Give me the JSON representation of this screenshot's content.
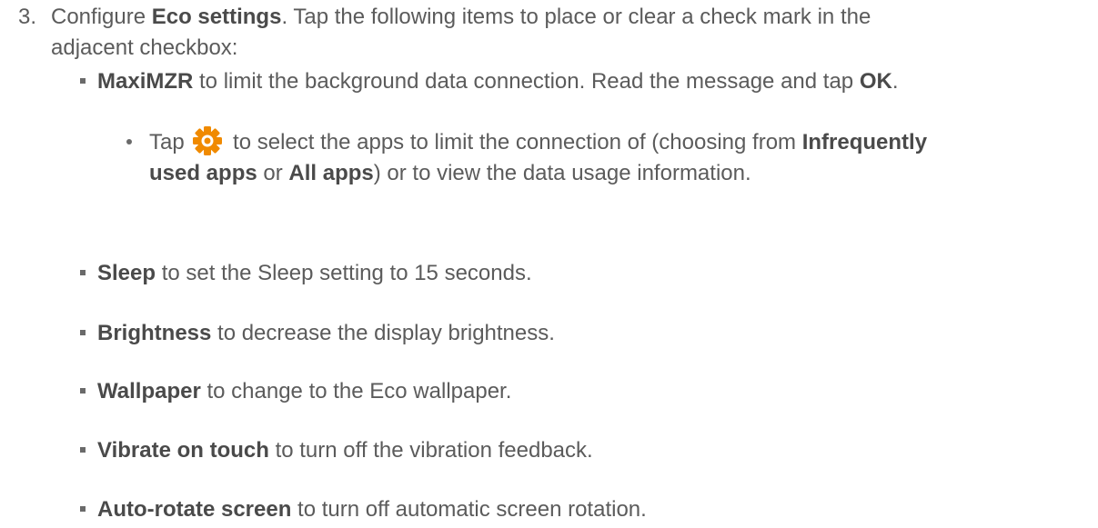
{
  "step": {
    "number": "3.",
    "line1": {
      "t1": "Configure ",
      "b1": "Eco settings",
      "t2": ". Tap the following items to place or clear a check mark in the"
    },
    "line2": "adjacent checkbox:"
  },
  "bullets": [
    {
      "bold": "MaxiMZR",
      "text": " to limit the background data connection. Read the message and tap ",
      "bold2": "OK",
      "text2": "."
    },
    {
      "bold": "Sleep",
      "text": " to set the Sleep setting to 15 seconds."
    },
    {
      "bold": "Brightness",
      "text": " to decrease the display brightness."
    },
    {
      "bold": "Wallpaper",
      "text": " to change to the Eco wallpaper."
    },
    {
      "bold": "Vibrate on touch",
      "text": " to turn off the vibration feedback."
    },
    {
      "bold": "Auto-rotate screen",
      "text": " to turn off automatic screen rotation."
    }
  ],
  "sub_bullet": {
    "t1": "Tap ",
    "icon": "gear-icon",
    "icon_color": "#f08a00",
    "t2": " to select the apps to limit the connection of (choosing from ",
    "b1": "Infrequently",
    "b2": "used apps",
    "t3": " or ",
    "b3": "All apps",
    "t4": ") or to view the data usage information."
  }
}
